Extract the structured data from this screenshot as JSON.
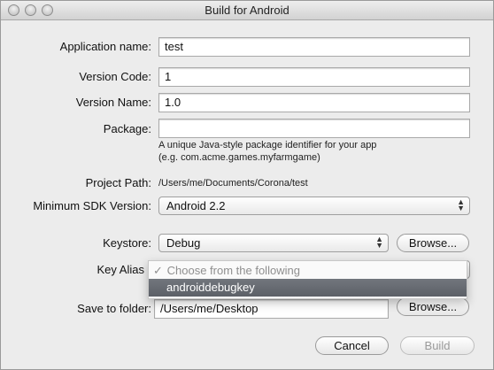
{
  "window": {
    "title": "Build for Android"
  },
  "labels": {
    "app_name": "Application name:",
    "version_code": "Version Code:",
    "version_name": "Version Name:",
    "package": "Package:",
    "project_path": "Project Path:",
    "min_sdk": "Minimum SDK Version:",
    "keystore": "Keystore:",
    "key_alias": "Key Alias",
    "save_folder": "Save to folder:"
  },
  "values": {
    "app_name": "test",
    "version_code": "1",
    "version_name": "1.0",
    "package": "",
    "project_path": "/Users/me/Documents/Corona/test",
    "min_sdk": "Android 2.2",
    "keystore": "Debug",
    "save_folder": "/Users/me/Desktop"
  },
  "hints": {
    "package_line1": "A unique Java-style package identifier for your app",
    "package_line2": "(e.g. com.acme.games.myfarmgame)"
  },
  "key_alias_menu": {
    "check": "✓",
    "header": "Choose from the following",
    "selected": "androiddebugkey"
  },
  "buttons": {
    "browse_keystore": "Browse...",
    "browse_folder": "Browse...",
    "cancel": "Cancel",
    "build": "Build"
  }
}
